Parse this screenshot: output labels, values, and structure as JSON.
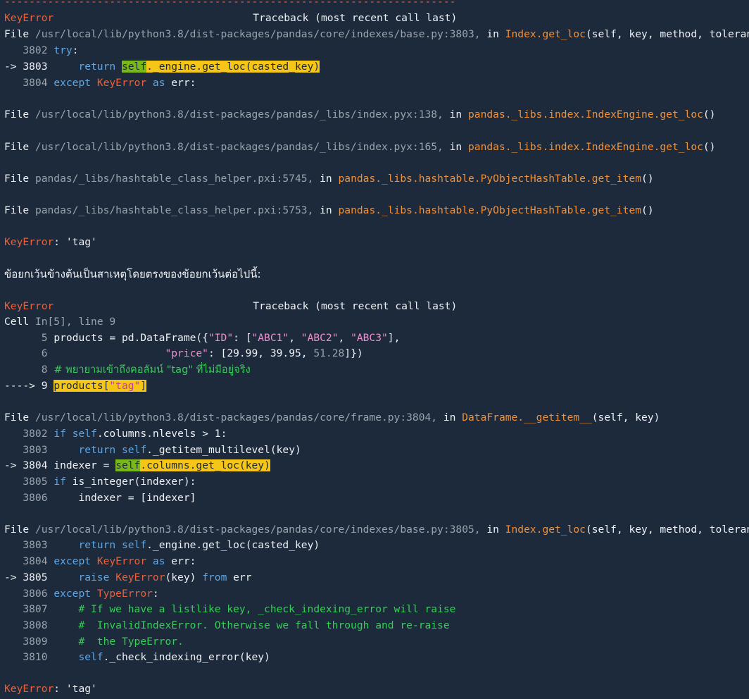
{
  "separator": "-------------------------------------------------------------------------",
  "tb1": {
    "header_err": "KeyError",
    "header_title": "Traceback (most recent call last)",
    "frame1": {
      "file_kw": "File",
      "path": "/usr/local/lib/python3.8/dist-packages/pandas/core/indexes/base.py:3803,",
      "in_kw": "in",
      "func": "Index.get_loc",
      "args": "(self, key, method, tolerance)",
      "l1_num": "   3802",
      "l1_kw": "try",
      "l1_rest": ":",
      "l2_num": "-> 3803",
      "l2_kw": "return",
      "l2_self": "self",
      "l2_rest": "._engine.get_loc(casted_key)",
      "l3_num": "   3804",
      "l3_kw": "except",
      "l3_exc": "KeyError",
      "l3_as": "as",
      "l3_rest": "err:"
    },
    "frame2": {
      "file_kw": "File",
      "path": "/usr/local/lib/python3.8/dist-packages/pandas/_libs/index.pyx:138,",
      "in_kw": "in",
      "func": "pandas._libs.index.IndexEngine.get_loc",
      "args": "()"
    },
    "frame3": {
      "file_kw": "File",
      "path": "/usr/local/lib/python3.8/dist-packages/pandas/_libs/index.pyx:165,",
      "in_kw": "in",
      "func": "pandas._libs.index.IndexEngine.get_loc",
      "args": "()"
    },
    "frame4": {
      "file_kw": "File",
      "path": "pandas/_libs/hashtable_class_helper.pxi:5745,",
      "in_kw": "in",
      "func": "pandas._libs.hashtable.PyObjectHashTable.get_item",
      "args": "()"
    },
    "frame5": {
      "file_kw": "File",
      "path": "pandas/_libs/hashtable_class_helper.pxi:5753,",
      "in_kw": "in",
      "func": "pandas._libs.hashtable.PyObjectHashTable.get_item",
      "args": "()"
    },
    "final_err": "KeyError",
    "final_msg": ": 'tag'"
  },
  "thai_message": "ข้อยกเว้นข้างต้นเป็นสาเหตุโดยตรงของข้อยกเว้นต่อไปนี้:",
  "tb2": {
    "header_err": "KeyError",
    "header_title": "Traceback (most recent call last)",
    "cell_kw": "Cell",
    "cell_ref": "In[5], line 9",
    "c5_num": "      5",
    "c5_a": "products = pd.DataFrame({",
    "c5_s1": "\"ID\"",
    "c5_b": ": [",
    "c5_s2": "\"ABC1\"",
    "c5_c": ", ",
    "c5_s3": "\"ABC2\"",
    "c5_d": ", ",
    "c5_s4": "\"ABC3\"",
    "c5_e": "],",
    "c6_num": "      6",
    "c6_pad": "                   ",
    "c6_s1": "\"price\"",
    "c6_b": ": [29.99, 39.95, ",
    "c6_n": "51.28",
    "c6_e": "]})",
    "c8_num": "      8",
    "c8_cmt": "# พยายามเข้าถึงคอลัมน์ \"tag\" ที่ไม่มีอยู่จริง",
    "c9_num": "----> 9",
    "c9_a": "products[",
    "c9_s": "\"tag\"",
    "c9_b": "]",
    "frameA": {
      "file_kw": "File",
      "path": "/usr/local/lib/python3.8/dist-packages/pandas/core/frame.py:3804,",
      "in_kw": "in",
      "func": "DataFrame.__getitem__",
      "args": "(self, key)",
      "a1_num": "   3802",
      "a1_kw": "if",
      "a1_self": "self",
      "a1_rest": ".columns.nlevels > 1:",
      "a2_num": "   3803",
      "a2_kw": "return",
      "a2_self": "self",
      "a2_rest": "._getitem_multilevel(key)",
      "a3_num": "-> 3804",
      "a3_a": "indexer = ",
      "a3_self": "self",
      "a3_rest": ".columns.get_loc(key)",
      "a4_num": "   3805",
      "a4_kw": "if",
      "a4_rest": "is_integer(indexer):",
      "a5_num": "   3806",
      "a5_rest": "indexer = [indexer]"
    },
    "frameB": {
      "file_kw": "File",
      "path": "/usr/local/lib/python3.8/dist-packages/pandas/core/indexes/base.py:3805,",
      "in_kw": "in",
      "func": "Index.get_loc",
      "args": "(self, key, method, tolerance)",
      "b1_num": "   3803",
      "b1_kw": "return",
      "b1_self": "self",
      "b1_rest": "._engine.get_loc(casted_key)",
      "b2_num": "   3804",
      "b2_kw": "except",
      "b2_exc": "KeyError",
      "b2_as": "as",
      "b2_rest": "err:",
      "b3_num": "-> 3805",
      "b3_kw": "raise",
      "b3_exc": "KeyError",
      "b3_mid": "(key)",
      "b3_from": "from",
      "b3_rest": "err",
      "b4_num": "   3806",
      "b4_kw": "except",
      "b4_exc": "TypeError",
      "b4_rest": ":",
      "b5_num": "   3807",
      "b5_cmt": "# If we have a listlike key, _check_indexing_error will raise",
      "b6_num": "   3808",
      "b6_cmt": "#  InvalidIndexError. Otherwise we fall through and re-raise",
      "b7_num": "   3809",
      "b7_cmt": "#  the TypeError.",
      "b8_num": "   3810",
      "b8_self": "self",
      "b8_rest": "._check_indexing_error(key)"
    },
    "final_err": "KeyError",
    "final_msg": ": 'tag'"
  }
}
